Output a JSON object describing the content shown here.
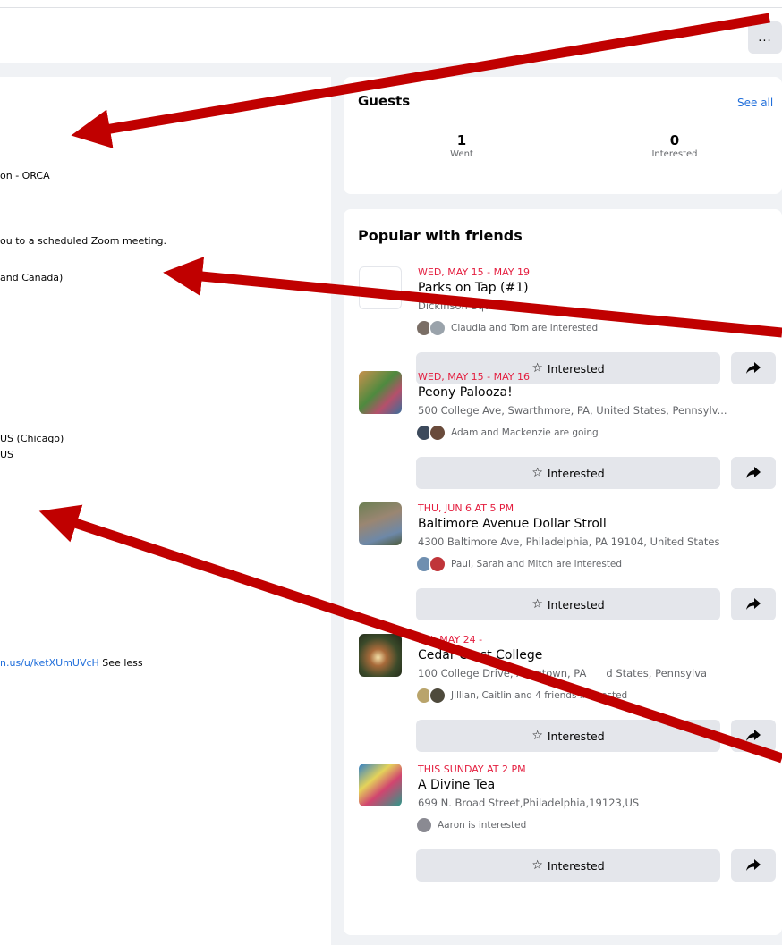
{
  "topbar": {
    "more_label": "..."
  },
  "left_panel": {
    "line1": "on - ORCA",
    "line2": "ou to a scheduled Zoom meeting.",
    "line3": " and Canada)",
    "line4": "US (Chicago)",
    "line5": "US",
    "link_text": "n.us/u/ketXUmUVcH",
    "see_less": " See less"
  },
  "guests": {
    "title": "Guests",
    "see_all": "See all",
    "went_count": "1",
    "went_label": "Went",
    "interested_count": "0",
    "interested_label": "Interested"
  },
  "popular": {
    "title": "Popular with friends",
    "interested_label": "Interested",
    "events": [
      {
        "date": "WED, MAY 15 - MAY 19",
        "title": "Parks on Tap (#1)",
        "location": "Dickinson Square",
        "friends": "Claudia and Tom are interested"
      },
      {
        "date": "WED, MAY 15 - MAY 16",
        "title": "Peony Palooza!",
        "location": "500 College Ave, Swarthmore, PA, United States, Pennsylv...",
        "friends": "Adam and Mackenzie are going"
      },
      {
        "date": "THU, JUN 6 AT 5 PM",
        "title": "Baltimore Avenue Dollar Stroll",
        "location": "4300 Baltimore Ave, Philadelphia, PA 19104, United States",
        "friends": "Paul, Sarah and Mitch are interested"
      },
      {
        "date": "FRI, MAY 24 -",
        "title": "Cedar Crest College",
        "location": "100 College Drive, Allentown, PA",
        "location2": "d States, Pennsylva",
        "friends": "Jillian, Caitlin and 4 friends interested"
      },
      {
        "date": "THIS SUNDAY AT 2 PM",
        "title": "A Divine Tea",
        "location": "699 N. Broad Street,Philadelphia,19123,US",
        "friends": "Aaron is interested"
      }
    ]
  },
  "colors": {
    "accent_red": "#e41e3f",
    "link_blue": "#216fdb",
    "arrow_red": "#c00000",
    "button_gray": "#e4e6eb"
  }
}
